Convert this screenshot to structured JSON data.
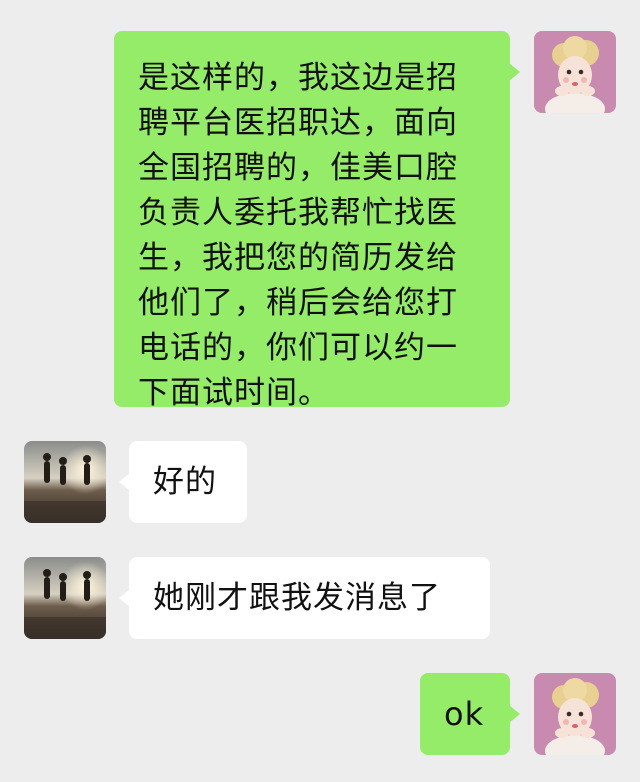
{
  "messages": [
    {
      "sender": "me",
      "text": "是这样的，我这边是招聘平台医招职达，面向全国招聘的，佳美口腔负责人委托我帮忙找医生，我把您的简历发给他们了，稍后会给您打电话的，你们可以约一下面试时间。"
    },
    {
      "sender": "other",
      "text": "好的"
    },
    {
      "sender": "other",
      "text": "她刚才跟我发消息了"
    },
    {
      "sender": "me",
      "text": "ok"
    }
  ],
  "colors": {
    "background": "#ededed",
    "my_bubble": "#95ec69",
    "their_bubble": "#ffffff"
  },
  "icons": {
    "my_avatar": "baby-doll-avatar",
    "their_avatar": "running-people-sunset-avatar"
  }
}
